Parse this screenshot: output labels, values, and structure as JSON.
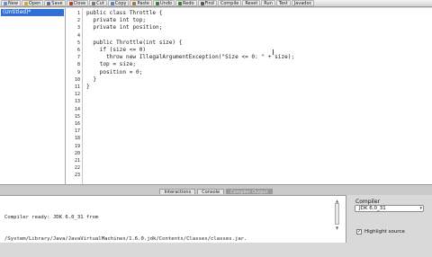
{
  "toolbar": {
    "buttons": [
      {
        "label": "New",
        "icon": "new-file-icon",
        "color": "#6b8fd6"
      },
      {
        "label": "Open",
        "icon": "open-folder-icon",
        "color": "#d8a23a"
      },
      {
        "label": "Save",
        "icon": "save-icon",
        "color": "#6a6a9a"
      },
      {
        "label": "Close",
        "icon": "close-file-icon",
        "color": "#b04040"
      },
      {
        "label": "Cut",
        "icon": "scissors-icon",
        "color": "#777777"
      },
      {
        "label": "Copy",
        "icon": "copy-icon",
        "color": "#5a7fc0"
      },
      {
        "label": "Paste",
        "icon": "paste-icon",
        "color": "#a07a3a"
      },
      {
        "label": "Undo",
        "icon": "undo-icon",
        "color": "#3a7a3a"
      },
      {
        "label": "Redo",
        "icon": "redo-icon",
        "color": "#3a7a3a"
      },
      {
        "label": "Find",
        "icon": "find-icon",
        "color": "#555555"
      },
      {
        "label": "Compile",
        "icon": "",
        "color": ""
      },
      {
        "label": "Reset",
        "icon": "",
        "color": ""
      },
      {
        "label": "Run",
        "icon": "",
        "color": ""
      },
      {
        "label": "Test",
        "icon": "",
        "color": ""
      },
      {
        "label": "Javadoc",
        "icon": "",
        "color": ""
      }
    ]
  },
  "files": {
    "items": [
      {
        "label": "(Untitled)*",
        "selected": true
      }
    ]
  },
  "editor": {
    "line_numbers": [
      "1",
      "2",
      "3",
      "4",
      "5",
      "6",
      "7",
      "8",
      "9",
      "10",
      "11",
      "12",
      "13",
      "14",
      "15",
      "16",
      "17",
      "18",
      "19",
      "20",
      "21",
      "22",
      "23"
    ],
    "lines": [
      "public class Throttle {",
      "  private int top;",
      "  private int position;",
      "",
      "  public Throttle(int size) {",
      "    if (size <= 0)",
      "      throw new IllegalArgumentException(\"Size <= 0: \" + size);",
      "    top = size;",
      "    position = 0;",
      "  }",
      "}"
    ]
  },
  "tabs": [
    {
      "label": "Interactions",
      "active": false
    },
    {
      "label": "Console",
      "active": false
    },
    {
      "label": "Compiler Output",
      "active": true
    }
  ],
  "console": {
    "lines": [
      "Compiler ready: JDK 6.0_31 from",
      "/System/Library/Java/JavaVirtualMachines/1.6.0.jdk/Contents/Classes/classes.jar."
    ]
  },
  "compiler_panel": {
    "label": "Compiler",
    "selected": "JDK 6.0_31",
    "highlight_label": "Highlight source",
    "highlight_checked": true
  }
}
